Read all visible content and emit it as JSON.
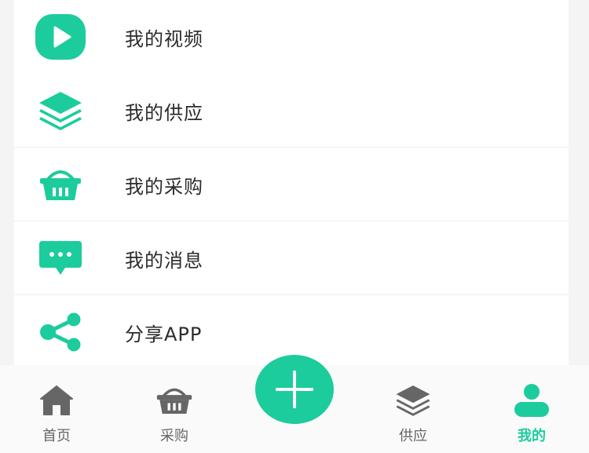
{
  "colors": {
    "accent": "#1ccc9c",
    "tab_inactive": "#666666",
    "text": "#2b2b2b",
    "background": "#f4f4f4"
  },
  "menu": {
    "items": [
      {
        "icon": "play-video-icon",
        "label": "我的视频"
      },
      {
        "icon": "layers-icon",
        "label": "我的供应"
      },
      {
        "icon": "basket-icon",
        "label": "我的采购"
      },
      {
        "icon": "chat-bubble-icon",
        "label": "我的消息"
      },
      {
        "icon": "share-icon",
        "label": "分享APP"
      }
    ]
  },
  "tabbar": {
    "tabs": [
      {
        "icon": "home-icon",
        "label": "首页",
        "active": false
      },
      {
        "icon": "basket-icon",
        "label": "采购",
        "active": false
      },
      {
        "icon": "layers-icon",
        "label": "供应",
        "active": false
      },
      {
        "icon": "user-icon",
        "label": "我的",
        "active": true
      }
    ],
    "center_button_icon": "plus-icon"
  }
}
